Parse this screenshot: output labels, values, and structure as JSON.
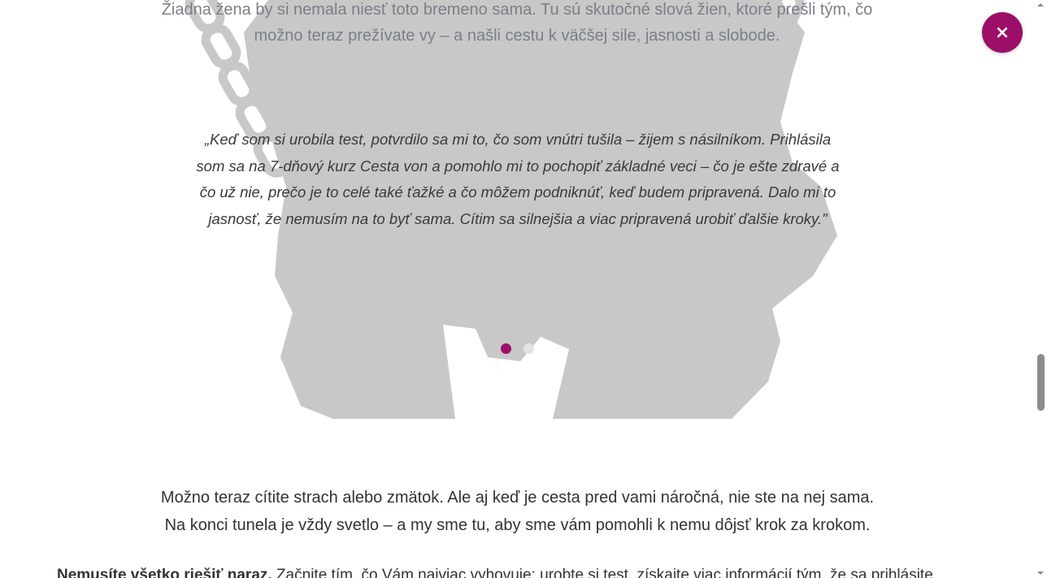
{
  "testimonials": {
    "intro": "Žiadna žena by si nemala niesť toto bremeno sama. Tu sú skutočné slová žien, ktoré prešli tým, čo možno teraz prežívate vy – a našli cestu k väčšej sile, jasnosti a slobode.",
    "quote": "„Keď som si urobila test, potvrdilo sa mi to, čo som vnútri tušila – žijem s násilníkom. Prihlásila som sa na 7-dňový kurz Cesta von a pomohlo mi to pochopiť základné veci – čo je ešte zdravé a čo už nie, prečo je to celé také ťažké a čo môžem podniknúť, keď budem pripravená. Dalo mi to jasnosť, že nemusím na to byť sama. Cítim sa silnejšia a viac pripravená urobiť ďalšie kroky.\"",
    "slide_count": 2,
    "active_slide": 1
  },
  "encouragement": {
    "line1": "Možno teraz cítite strach alebo zmätok. Ale aj keď je cesta pred vami náročná, nie ste na nej sama.",
    "line2": "Na konci tunela je vždy svetlo – a my sme tu, aby sme vám pomohli k nemu dôjsť krok za krokom."
  },
  "cta": {
    "bold": "Nemusíte všetko riešiť naraz.",
    "text": " Začnite tím, čo Vám najviac vyhovuje: urobte si test, získajte viac informácií tým, že sa prihlásite"
  },
  "close_button": {
    "label": "×",
    "color": "#9c0f68"
  },
  "colors": {
    "accent": "#9c0f68",
    "dot_inactive": "#e3e3e6",
    "silhouette": "#c8c8c9",
    "intro_text": "#7b7f86",
    "body_text": "#333333"
  }
}
